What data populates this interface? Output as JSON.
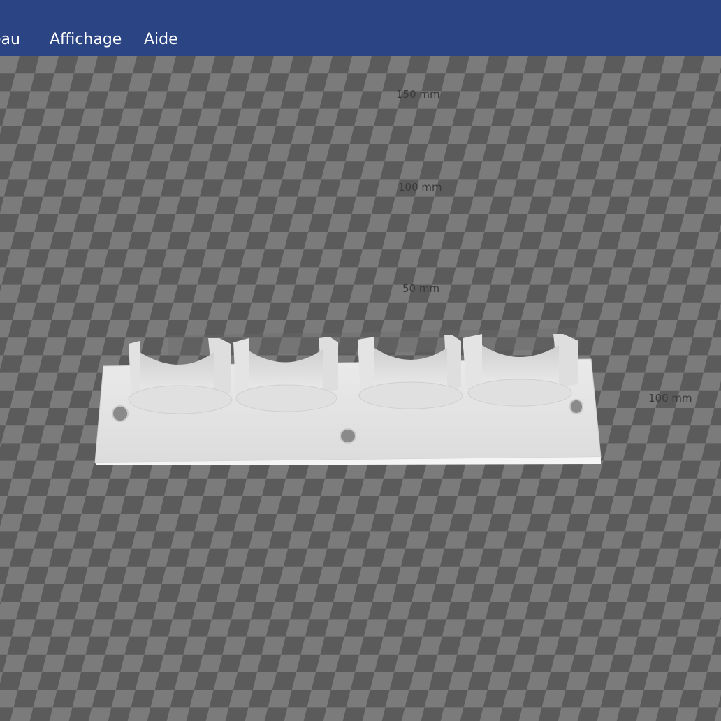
{
  "menu": {
    "items": [
      {
        "label": "eau"
      },
      {
        "label": "Affichage"
      },
      {
        "label": "Aide"
      }
    ]
  },
  "viewport": {
    "rulers": [
      {
        "label": "150 mm"
      },
      {
        "label": "100 mm"
      },
      {
        "label": "50 mm"
      },
      {
        "label": "100 mm"
      }
    ],
    "colors": {
      "bed_light": "#7a7a7a",
      "bed_dark": "#5a5a5a",
      "model": "#e6e6e6",
      "menubar": "#2b4484"
    }
  }
}
